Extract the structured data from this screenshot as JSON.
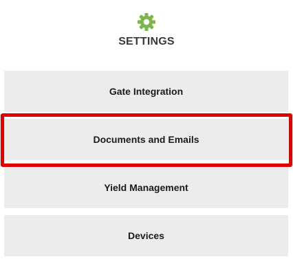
{
  "header": {
    "icon": "gear-icon",
    "title": "SETTINGS",
    "icon_color": "#7ab648"
  },
  "menu": {
    "items": [
      {
        "label": "Gate Integration"
      },
      {
        "label": "Documents and Emails",
        "highlighted": true
      },
      {
        "label": "Yield Management"
      },
      {
        "label": "Devices"
      }
    ]
  },
  "colors": {
    "item_background": "#ececec",
    "highlight_border": "#e00000",
    "title_text": "#3a3a3a"
  }
}
